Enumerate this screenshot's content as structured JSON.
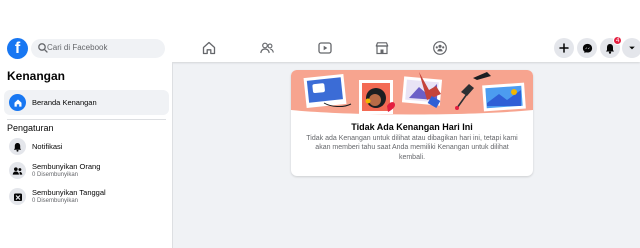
{
  "header": {
    "logo_letter": "f",
    "search_placeholder": "Cari di Facebook",
    "notification_count": "4",
    "icons": [
      "home-icon",
      "friends-icon",
      "watch-icon",
      "marketplace-icon",
      "groups-icon",
      "plus-icon",
      "messenger-icon",
      "bell-icon",
      "chevron-down-icon"
    ]
  },
  "sidebar": {
    "title": "Kenangan",
    "home_label": "Beranda Kenangan",
    "settings_heading": "Pengaturan",
    "items": [
      {
        "label": "Notifikasi",
        "sub": ""
      },
      {
        "label": "Sembunyikan Orang",
        "sub": "0 Disembunyikan"
      },
      {
        "label": "Sembunyikan Tanggal",
        "sub": "0 Disembunyikan"
      }
    ]
  },
  "main": {
    "title": "Tidak Ada Kenangan Hari Ini",
    "text": "Tidak ada Kenangan untuk dilihat atau dibagikan hari ini, tetapi kami akan memberi tahu saat Anda memiliki Kenangan untuk dilihat kembali."
  },
  "colors": {
    "brand": "#1877f2",
    "badge": "#e41e3f",
    "illustration_bg": "#f7a48f"
  }
}
